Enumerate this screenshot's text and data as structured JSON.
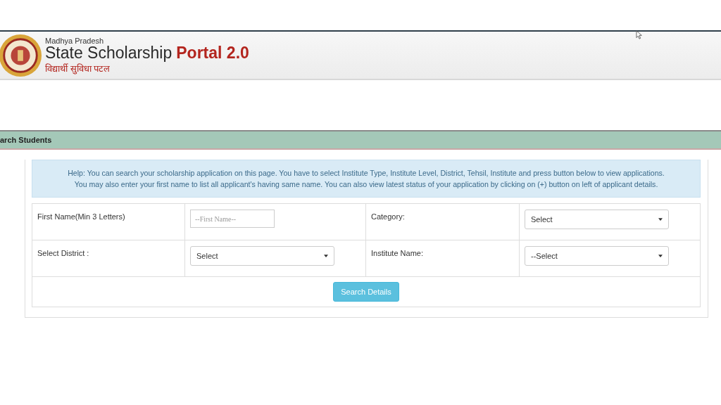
{
  "header": {
    "state": "Madhya Pradesh",
    "title": "State Scholarship",
    "title_accent": "Portal 2.0",
    "tagline": "विद्यार्थी सुविधा पटल"
  },
  "section": {
    "title": "arch Students"
  },
  "help": [
    "Help: You can search your scholarship application on this page. You have to select Institute Type, Institute Level, District, Tehsil, Institute and press button below to view applications.",
    "You may also enter your first name to list all applicant's having same name. You can also view latest status of your application by clicking on (+) button on left of applicant details."
  ],
  "form": {
    "rows": [
      {
        "fields": [
          {
            "label": "First Name(Min 3 Letters)",
            "kind": "text",
            "placeholder": "--First Name--"
          },
          {
            "label": "Category:",
            "kind": "select",
            "value": "Select"
          }
        ]
      },
      {
        "fields": [
          {
            "label": "Select District :",
            "kind": "select",
            "value": "Select"
          },
          {
            "label": "Institute Name:",
            "kind": "select",
            "value": "--Select"
          }
        ]
      }
    ],
    "button": "Search Details"
  }
}
